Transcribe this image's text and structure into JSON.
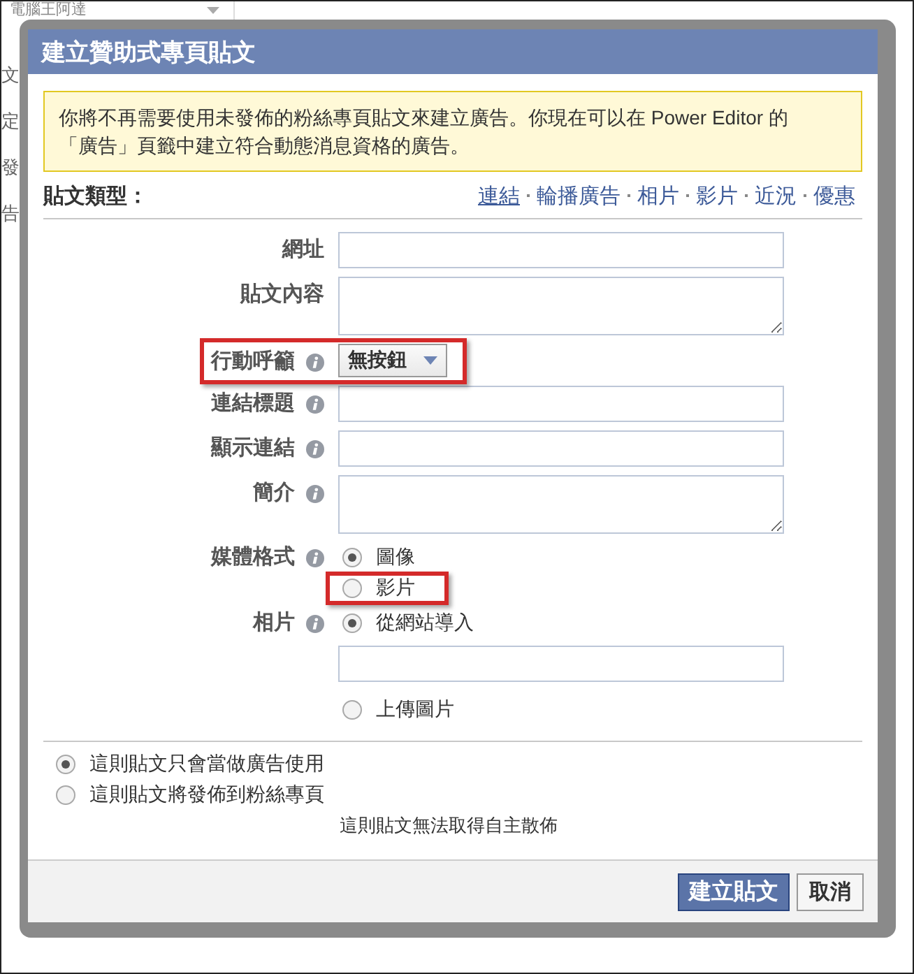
{
  "background": {
    "page_selector": "電腦王阿達",
    "side_texts": [
      "文",
      "定",
      "發",
      "告"
    ]
  },
  "dialog": {
    "title": "建立贊助式專頁貼文",
    "notice": "你將不再需要使用未發佈的粉絲專頁貼文來建立廣告。你現在可以在 Power Editor 的「廣告」頁籤中建立符合動態消息資格的廣告。",
    "post_type": {
      "label": "貼文類型：",
      "options": [
        {
          "label": "連結",
          "selected": true
        },
        {
          "label": "輪播廣告",
          "selected": false
        },
        {
          "label": "相片",
          "selected": false
        },
        {
          "label": "影片",
          "selected": false
        },
        {
          "label": "近況",
          "selected": false
        },
        {
          "label": "優惠",
          "selected": false
        }
      ]
    },
    "fields": [
      {
        "kind": "input",
        "label": "網址",
        "info": false,
        "highlighted": false
      },
      {
        "kind": "textarea",
        "label": "貼文內容",
        "info": false,
        "highlighted": false
      },
      {
        "kind": "dropdown",
        "label": "行動呼籲",
        "info": true,
        "value": "無按鈕",
        "highlighted": true
      },
      {
        "kind": "input",
        "label": "連結標題",
        "info": true,
        "highlighted": false
      },
      {
        "kind": "input",
        "label": "顯示連結",
        "info": true,
        "highlighted": false
      },
      {
        "kind": "textarea",
        "label": "簡介",
        "info": true,
        "highlighted": false
      },
      {
        "kind": "radios",
        "label": "媒體格式",
        "info": true,
        "highlighted": false,
        "options": [
          {
            "label": "圖像",
            "selected": true,
            "highlighted": false
          },
          {
            "label": "影片",
            "selected": false,
            "highlighted": true
          }
        ]
      },
      {
        "kind": "photo",
        "label": "相片",
        "info": true,
        "highlighted": false,
        "options": [
          {
            "label": "從網站導入",
            "selected": true,
            "highlighted": false
          },
          {
            "label": "上傳圖片",
            "selected": false,
            "highlighted": false
          }
        ]
      }
    ],
    "distribution": {
      "options": [
        {
          "label": "這則貼文只會當做廣告使用",
          "selected": true
        },
        {
          "label": "這則貼文將發佈到粉絲專頁",
          "selected": false
        }
      ],
      "note": "這則貼文無法取得自主散佈"
    },
    "buttons": [
      {
        "label": "建立貼文",
        "kind": "primary"
      },
      {
        "label": "取消",
        "kind": "secondary"
      }
    ]
  }
}
